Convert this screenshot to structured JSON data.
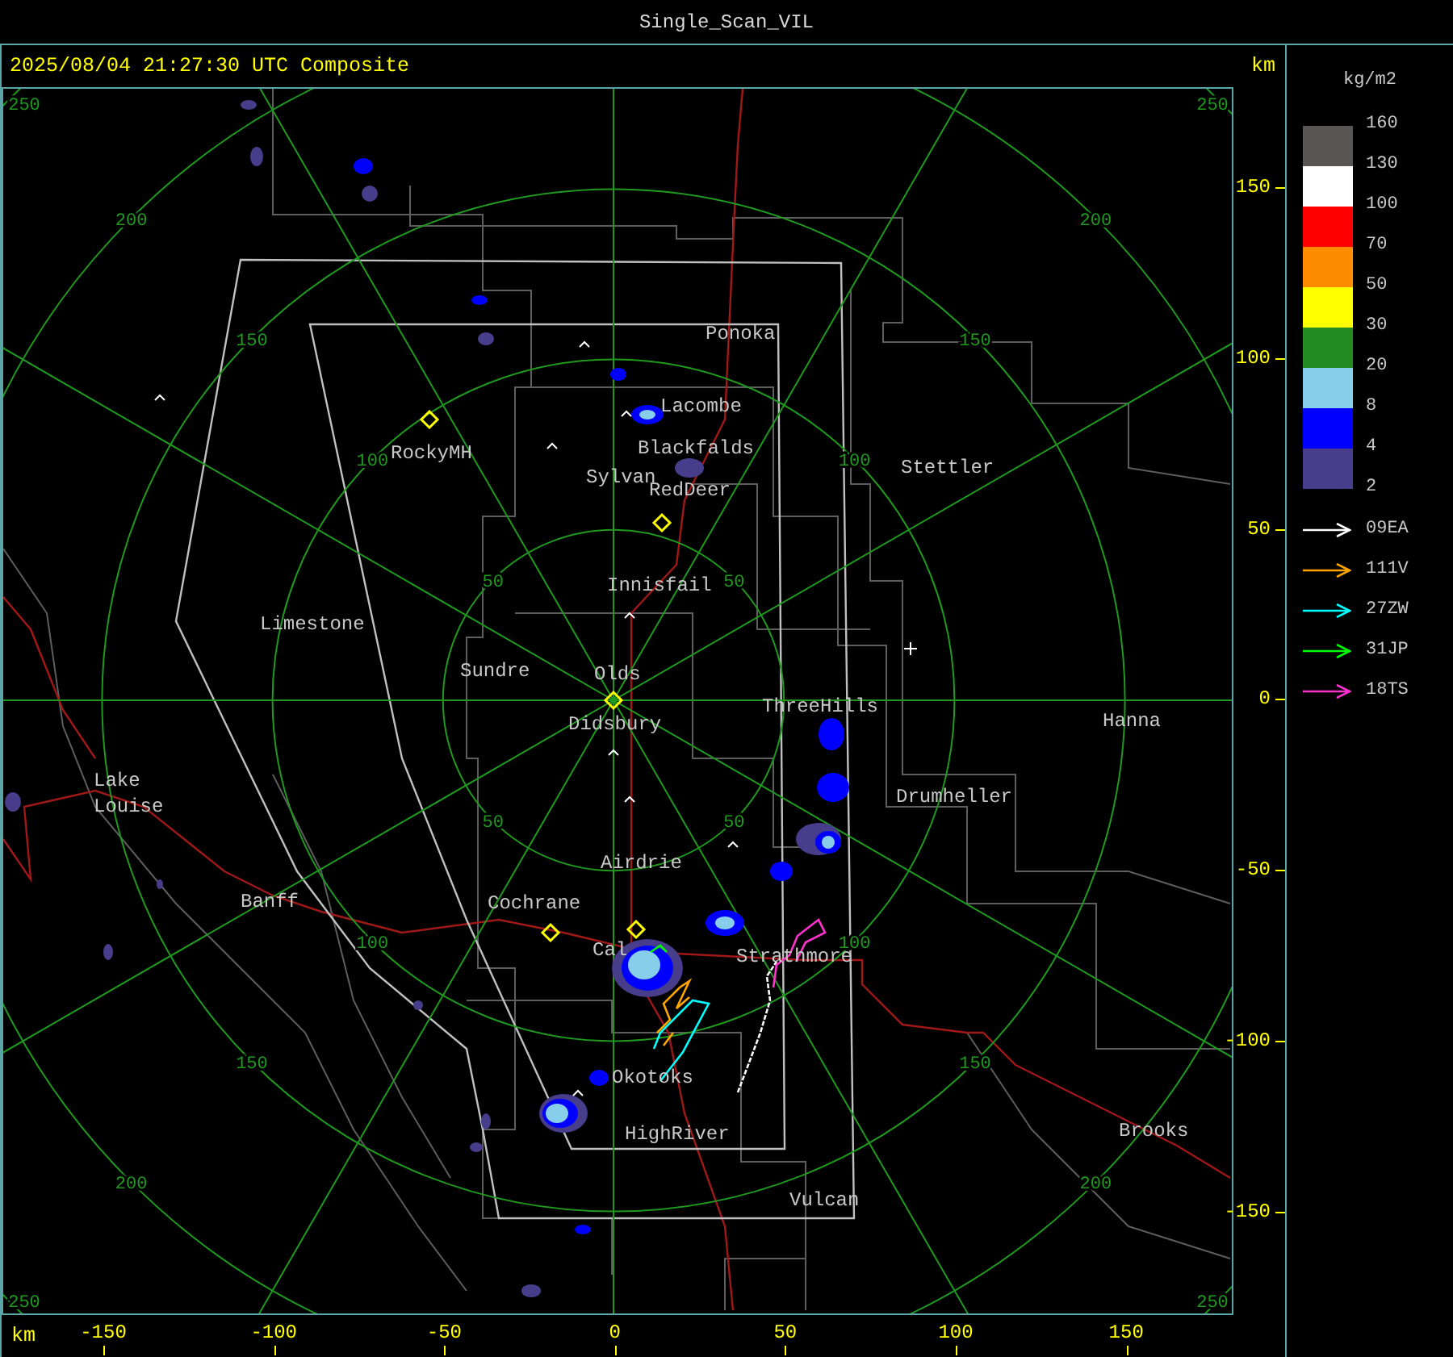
{
  "window": {
    "title": "Single_Scan_VIL"
  },
  "header": {
    "timestamp": "2025/08/04 21:27:30 UTC Composite",
    "unit": "km"
  },
  "map": {
    "towns": [
      {
        "name": "Ponoka"
      },
      {
        "name": "Lacombe"
      },
      {
        "name": "Blackfalds"
      },
      {
        "name": "Sylvan"
      },
      {
        "name": "RedDeer"
      },
      {
        "name": "RockyMH"
      },
      {
        "name": "Stettler"
      },
      {
        "name": "Innisfail"
      },
      {
        "name": "Limestone"
      },
      {
        "name": "Sundre"
      },
      {
        "name": "Olds"
      },
      {
        "name": "Didsbury"
      },
      {
        "name": "ThreeHills"
      },
      {
        "name": "Hanna"
      },
      {
        "name": "Lake Louise"
      },
      {
        "name": "Drumheller"
      },
      {
        "name": "Airdrie"
      },
      {
        "name": "Cochrane"
      },
      {
        "name": "Banff"
      },
      {
        "name": "Cal"
      },
      {
        "name": "Strathmore"
      },
      {
        "name": "Okotoks"
      },
      {
        "name": "HighRiver"
      },
      {
        "name": "Vulcan"
      },
      {
        "name": "Brooks"
      }
    ],
    "range_rings": [
      {
        "nw": "50",
        "ne": "50",
        "sw": "50",
        "se": "50"
      },
      {
        "nw": "100",
        "ne": "100",
        "sw": "100",
        "se": "100"
      },
      {
        "nw": "150",
        "ne": "150",
        "sw": "150",
        "se": "150"
      },
      {
        "nw": "200",
        "ne": "200",
        "sw": "200",
        "se": "200"
      },
      {
        "nw": "250",
        "ne": "250",
        "sw": "250",
        "se": "250"
      }
    ]
  },
  "y_axis": {
    "ticks": [
      "150",
      "100",
      "50",
      "0",
      "-50",
      "-100",
      "-150"
    ]
  },
  "x_axis": {
    "unit": "km",
    "ticks": [
      "-150",
      "-100",
      "-50",
      "0",
      "50",
      "100",
      "150"
    ]
  },
  "legend": {
    "unit": "kg/m2",
    "swatches": [
      {
        "color": "#595555"
      },
      {
        "color": "#ffffff"
      },
      {
        "color": "#ff0000"
      },
      {
        "color": "#ff8c00"
      },
      {
        "color": "#ffff00"
      },
      {
        "color": "#228b22"
      },
      {
        "color": "#87ceeb"
      },
      {
        "color": "#0000ff"
      },
      {
        "color": "#483d8b"
      }
    ],
    "labels": [
      "160",
      "130",
      "100",
      "70",
      "50",
      "30",
      "20",
      "8",
      "4",
      "2"
    ],
    "tracks": [
      {
        "label": "09EA",
        "color": "#ffffff"
      },
      {
        "label": "111V",
        "color": "#ffa500"
      },
      {
        "label": "27ZW",
        "color": "#00ffff"
      },
      {
        "label": "31JP",
        "color": "#00ff00"
      },
      {
        "label": "18TS",
        "color": "#ff33cc"
      }
    ]
  }
}
